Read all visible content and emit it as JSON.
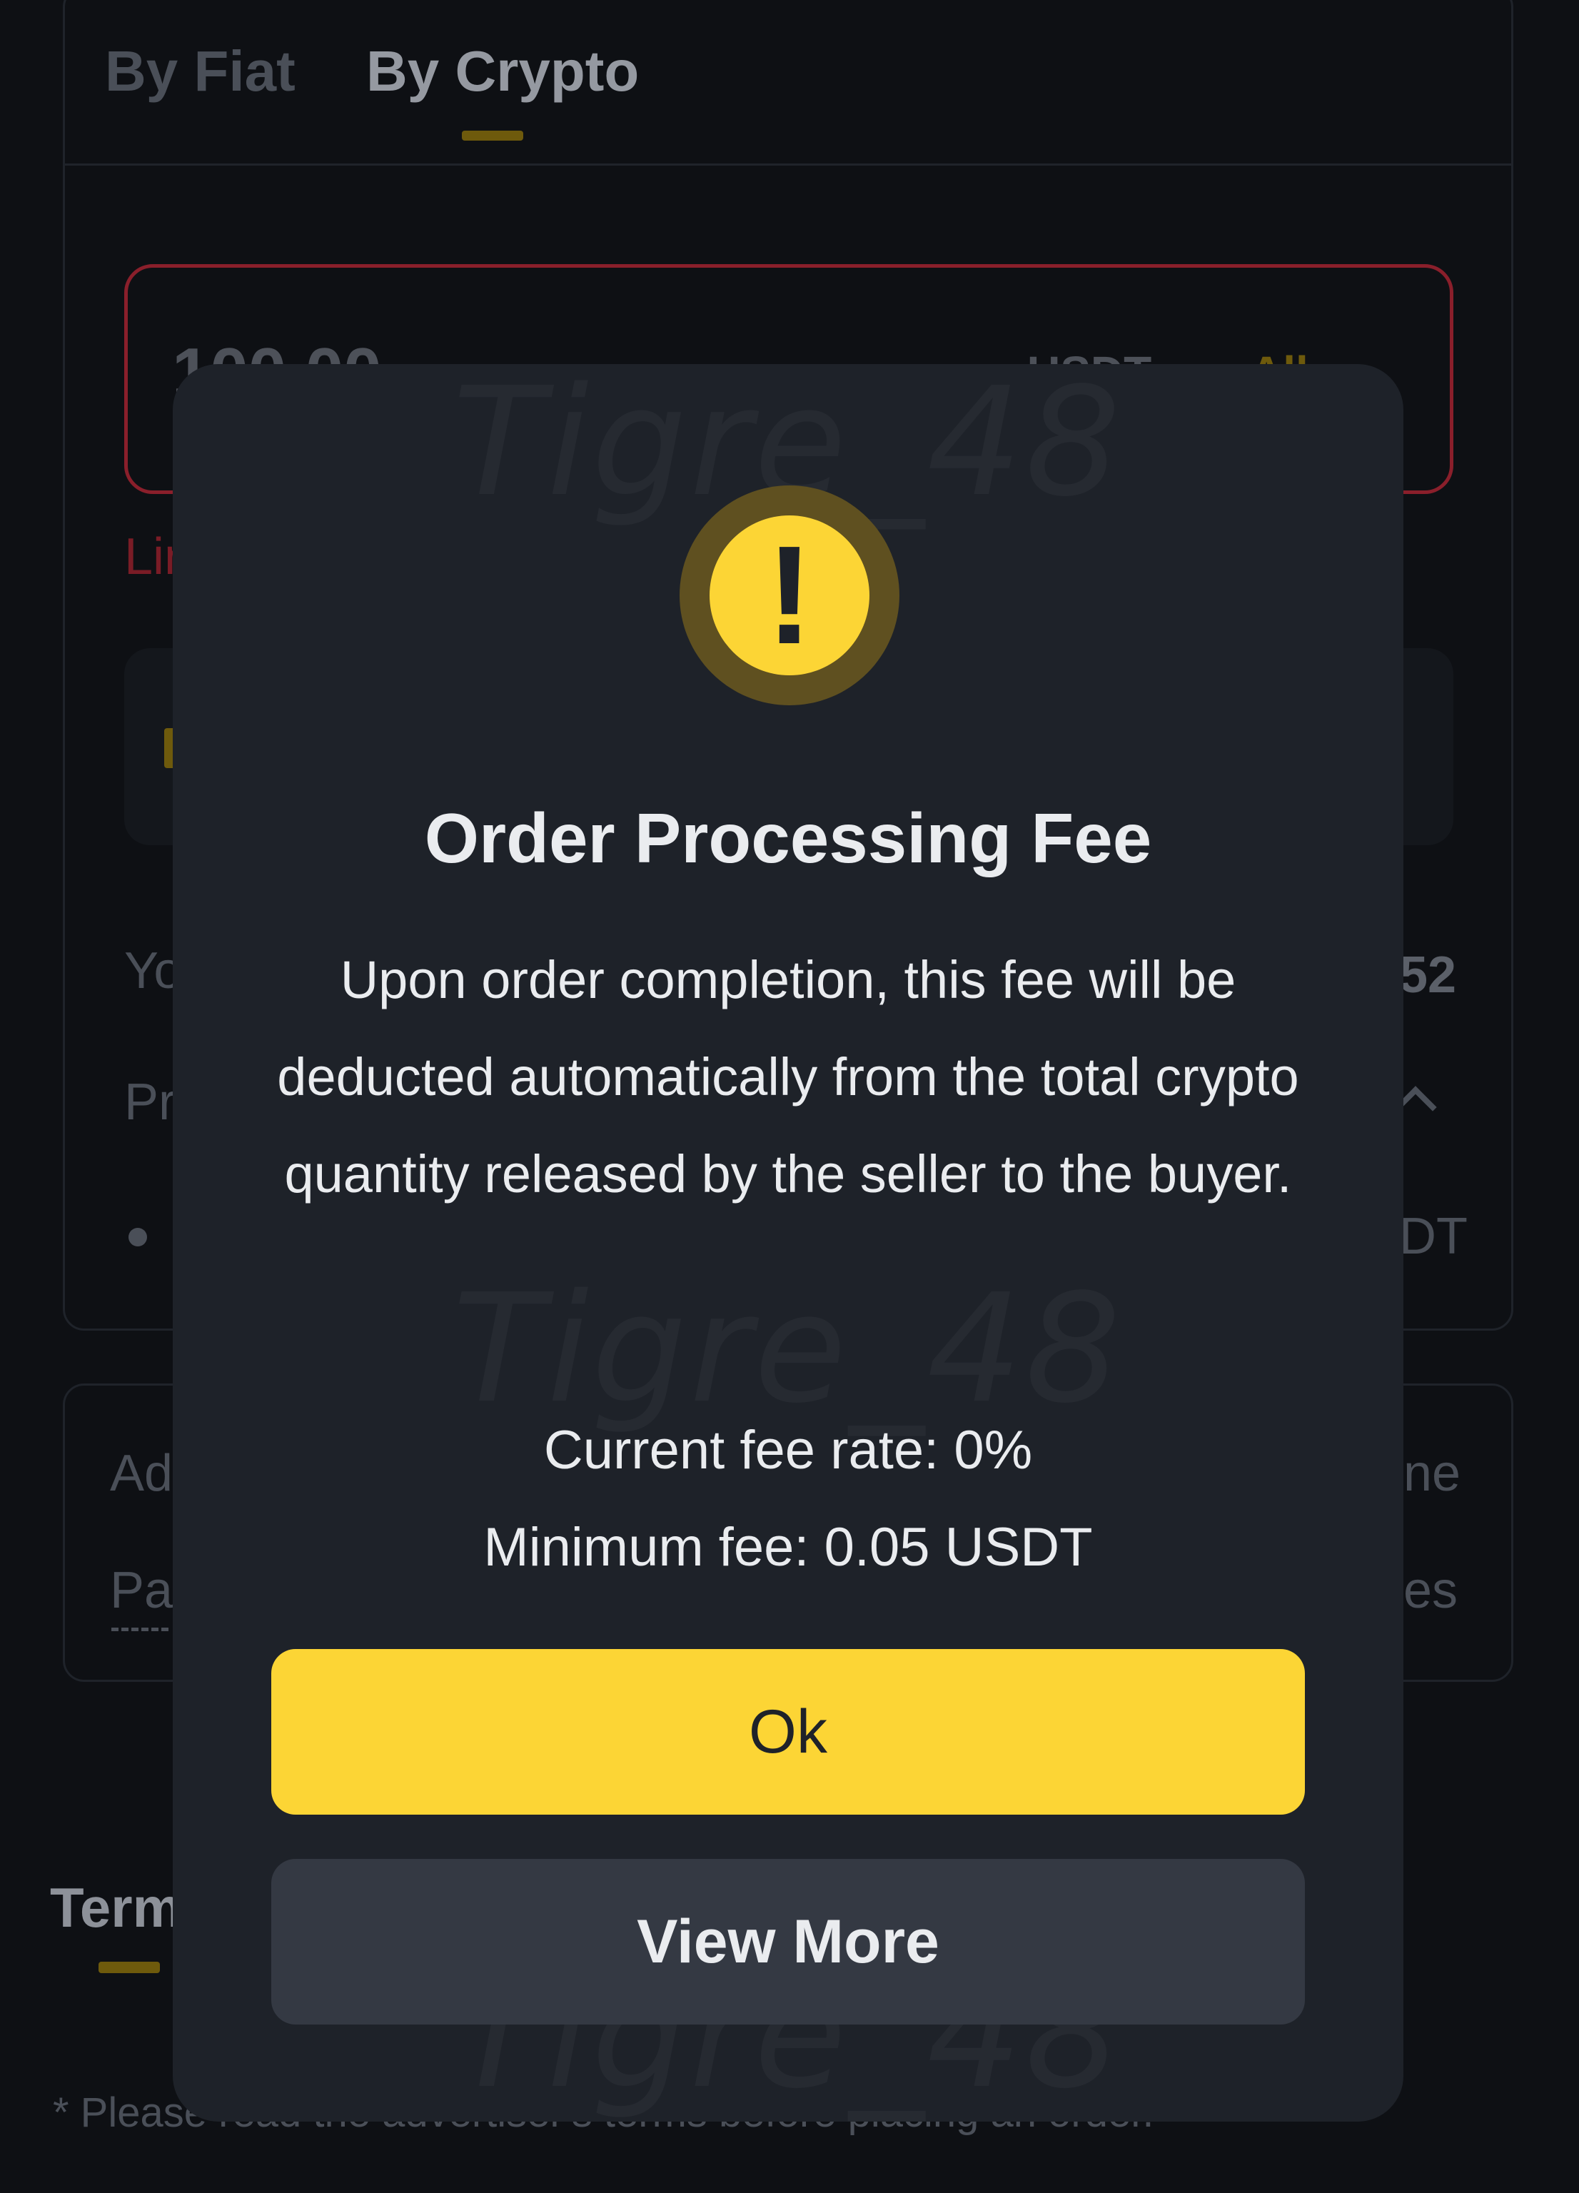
{
  "background": {
    "tabs": [
      {
        "label": "By Fiat",
        "active": false
      },
      {
        "label": "By Crypto",
        "active": true
      }
    ],
    "amount_input": {
      "value": "100.00",
      "unit": "USDT",
      "all_label": "All"
    },
    "limit_fragment": "Lin",
    "you_fragment": "Yo",
    "you_value_fragment": "52",
    "pr_fragment": "Pr",
    "unit_fragment": "DT",
    "advertiser_fragment": "Ad",
    "advertiser_right_fragment": "ne",
    "payment_fragment": "Pa",
    "payment_right_fragment": "es",
    "terms_fragment": "Term",
    "footer_note": "* Please read the advertiser's terms before placing an order."
  },
  "watermark": "Tigre_48",
  "modal": {
    "icon": "warning-icon",
    "title": "Order Processing Fee",
    "body": "Upon order completion, this fee will be deducted automatically from the total crypto quantity released by the seller to the buyer.",
    "fee_rate": "Current fee rate: 0%",
    "min_fee": "Minimum fee: 0.05 USDT",
    "ok_label": "Ok",
    "view_more_label": "View More"
  },
  "colors": {
    "accent": "#fcd535",
    "modal_bg": "#1e2229",
    "page_bg": "#0e1014",
    "error": "#8a1f2b"
  }
}
